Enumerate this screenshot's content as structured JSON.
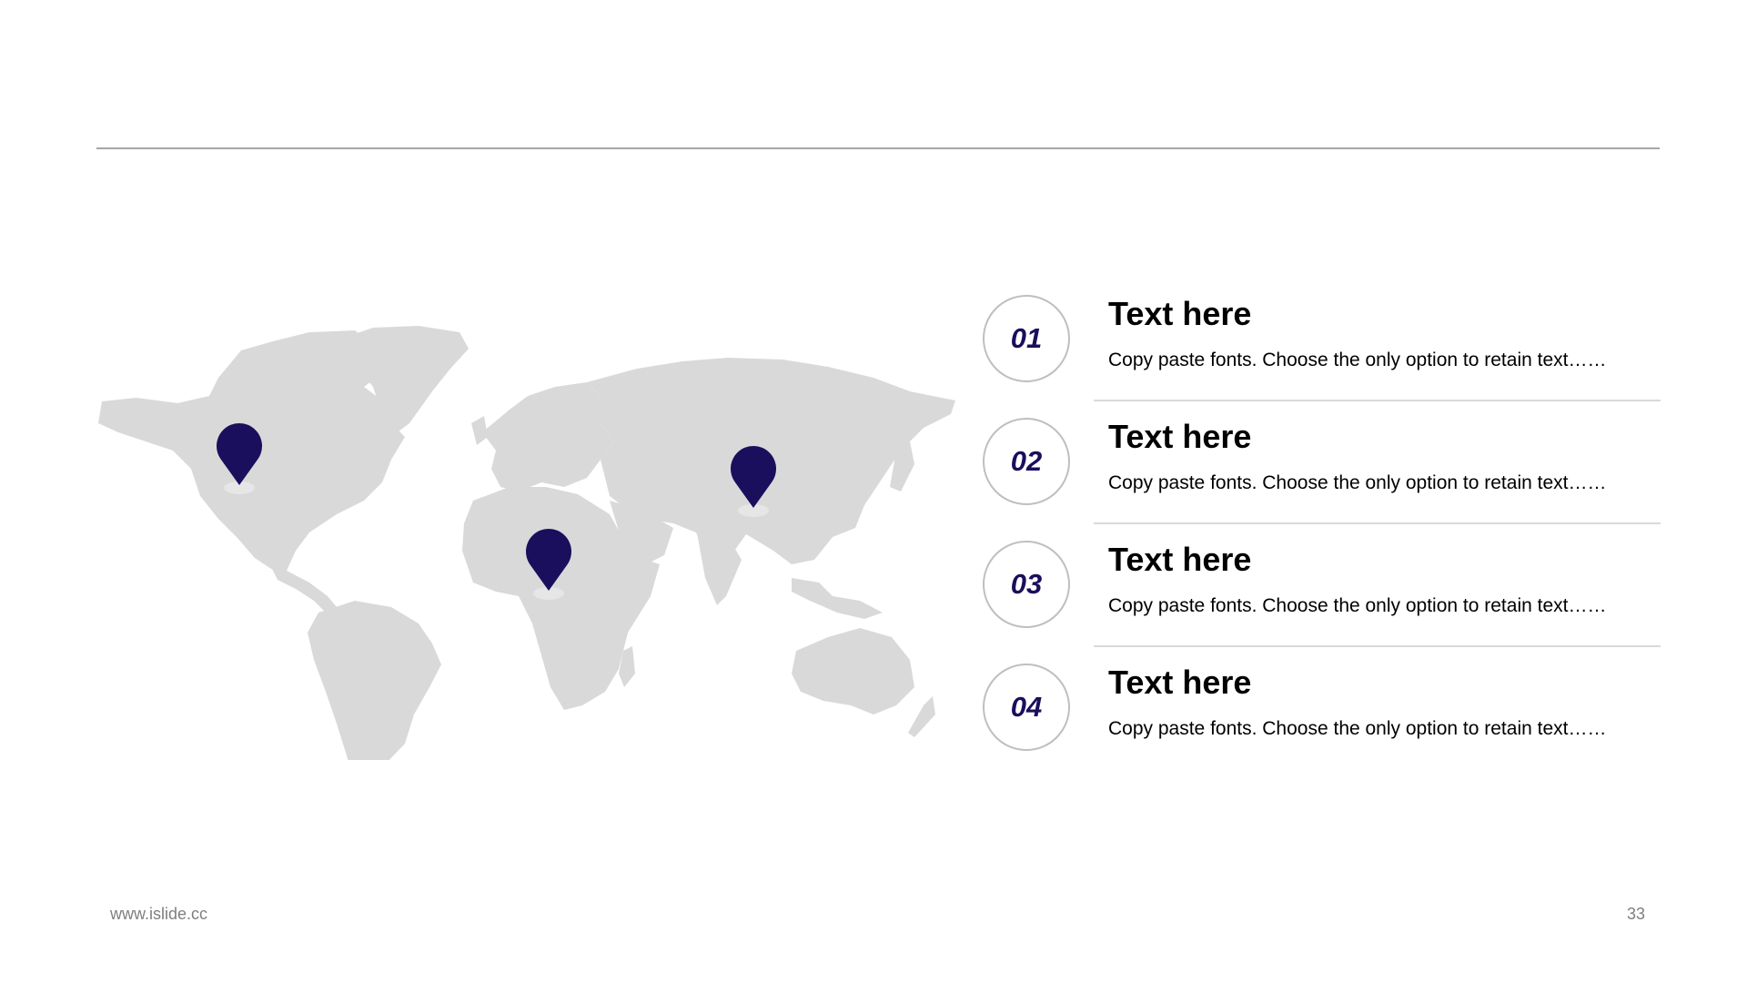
{
  "map": {
    "land_color": "#d9d9d9",
    "pin_color": "#1a0f5c",
    "pins": [
      "north-america",
      "africa",
      "china"
    ]
  },
  "items": [
    {
      "number": "01",
      "title": "Text here",
      "desc": "Copy paste fonts. Choose the only option to retain text……"
    },
    {
      "number": "02",
      "title": "Text here",
      "desc": "Copy paste fonts. Choose the only option to retain text……"
    },
    {
      "number": "03",
      "title": "Text here",
      "desc": "Copy paste fonts. Choose the only option to retain text……"
    },
    {
      "number": "04",
      "title": "Text here",
      "desc": "Copy paste fonts. Choose the only option to retain text……"
    }
  ],
  "footer": {
    "site": "www.islide.cc",
    "page": "33"
  }
}
